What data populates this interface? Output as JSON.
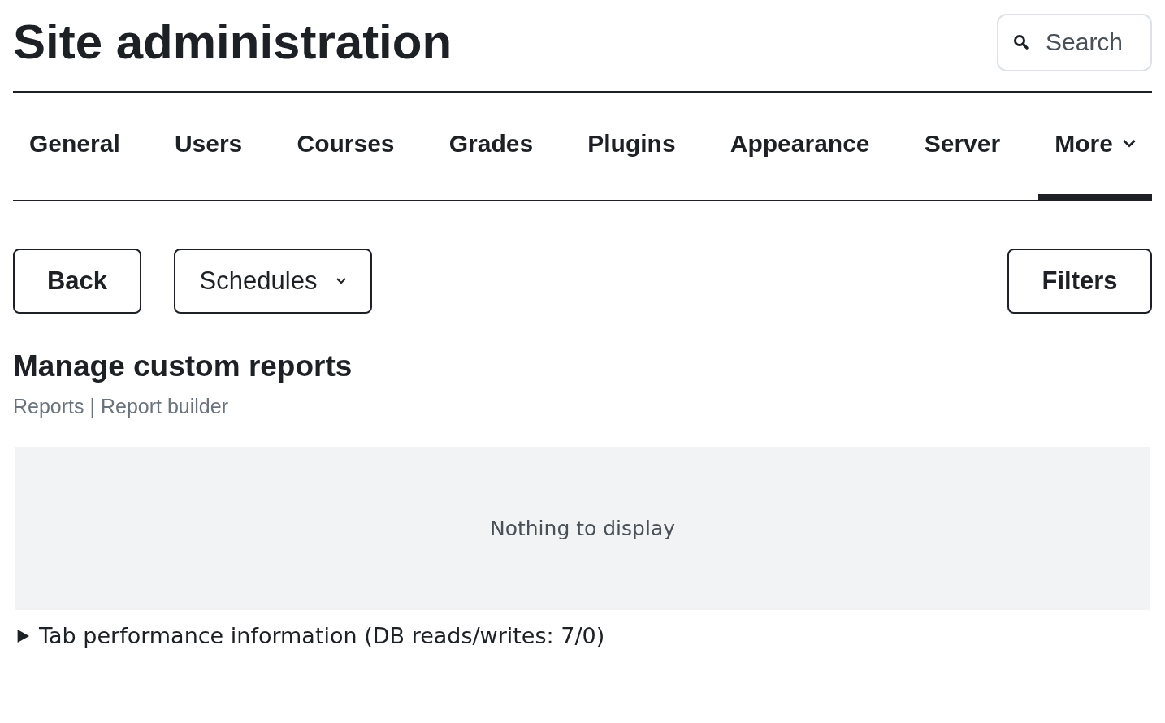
{
  "header": {
    "title": "Site administration",
    "search": {
      "placeholder": "Search"
    }
  },
  "tabs": [
    {
      "label": "General",
      "selected": false,
      "dropdown": false
    },
    {
      "label": "Users",
      "selected": false,
      "dropdown": false
    },
    {
      "label": "Courses",
      "selected": false,
      "dropdown": false
    },
    {
      "label": "Grades",
      "selected": false,
      "dropdown": false
    },
    {
      "label": "Plugins",
      "selected": false,
      "dropdown": false
    },
    {
      "label": "Appearance",
      "selected": false,
      "dropdown": false
    },
    {
      "label": "Server",
      "selected": false,
      "dropdown": false
    },
    {
      "label": "More",
      "selected": true,
      "dropdown": true
    }
  ],
  "toolbar": {
    "back": "Back",
    "schedules": "Schedules",
    "filters": "Filters"
  },
  "section": {
    "title": "Manage custom reports",
    "subtitle": "Reports | Report builder"
  },
  "table": {
    "empty_message": "Nothing to display"
  },
  "performance": {
    "label": "Tab performance information (DB reads/writes: 7/0)",
    "expanded": false
  }
}
